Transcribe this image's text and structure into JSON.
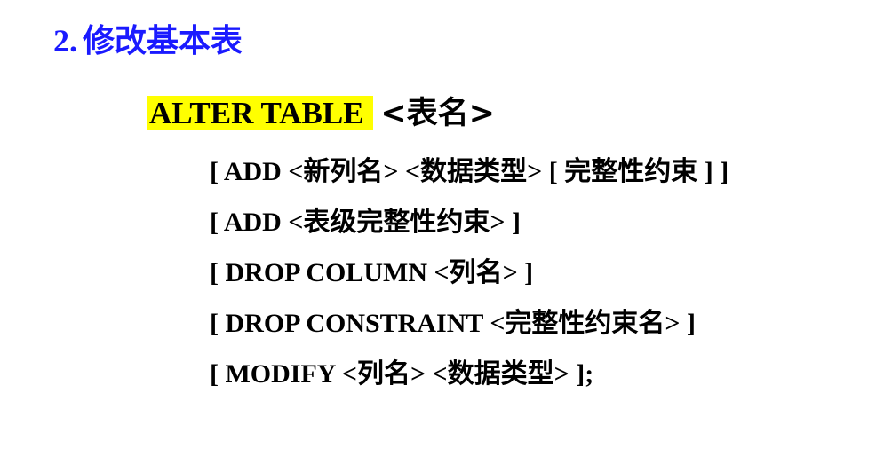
{
  "title": {
    "number": "2.",
    "text": "修改基本表"
  },
  "syntax": {
    "keyword": "ALTER TABLE",
    "table_name": "<表名>",
    "clauses": [
      "[ ADD <新列名> <数据类型> [ 完整性约束 ] ]",
      "[ ADD <表级完整性约束> ]",
      "[ DROP  COLUMN <列名> ]",
      "[ DROP CONSTRAINT <完整性约束名> ]",
      "[ MODIFY <列名> <数据类型> ];"
    ]
  },
  "colors": {
    "title": "#1a1aff",
    "highlight": "#ffff00",
    "text": "#000000"
  }
}
